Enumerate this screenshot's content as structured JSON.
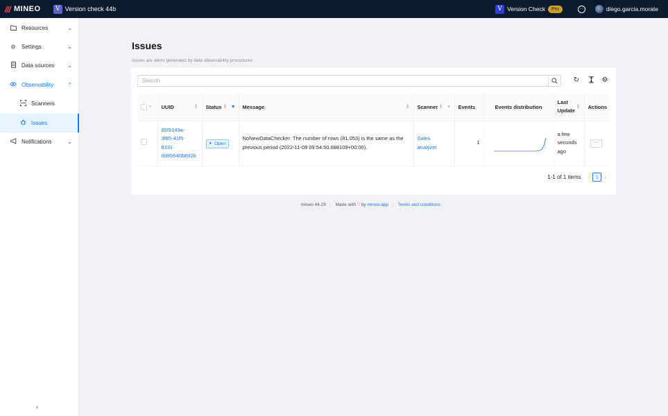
{
  "topbar": {
    "brand": "MINEO",
    "project_badge": "V",
    "project_name": "Version check 44b",
    "version_badge": "V",
    "version_name": "Version Check",
    "plan": "Pro",
    "user": "diego.garcia.morate"
  },
  "sidebar": {
    "items": [
      {
        "label": "Resources",
        "icon": "folder-icon"
      },
      {
        "label": "Settings",
        "icon": "gear-icon"
      },
      {
        "label": "Data sources",
        "icon": "database-icon"
      },
      {
        "label": "Observability",
        "icon": "eye-icon"
      },
      {
        "label": "Scanners",
        "icon": "scan-icon"
      },
      {
        "label": "Issues",
        "icon": "bug-icon"
      },
      {
        "label": "Notifications",
        "icon": "megaphone-icon"
      }
    ],
    "active": "Issues"
  },
  "page": {
    "title": "Issues",
    "subtitle": "Issues are alerts generated by data observability procedures"
  },
  "search": {
    "placeholder": "Search"
  },
  "table": {
    "columns": [
      "UUID",
      "Status",
      "Message",
      "Scanner",
      "Events",
      "Events distribution",
      "Last Update",
      "Actions"
    ],
    "rows": [
      {
        "uuid": "85f3143a-3f85-41f5-8331-dd85640b892b",
        "uuid_lines": [
          "85f3143a-",
          "3f85-41f5-",
          "8331-",
          "dd85640b892b"
        ],
        "status": "Open",
        "message": "NoNewDataChecker: The number of rows (81,053) is the same as the previous period (2022-11-09 09:54:50.688109+00:00).",
        "scanner": "Sales analyzer",
        "scanner_lines": [
          "Sales",
          "analyzer"
        ],
        "events": "1",
        "last_update": "a few seconds ago",
        "last_update_lines": [
          "a few",
          "seconds",
          "ago"
        ],
        "actions": "···"
      }
    ]
  },
  "pagination": {
    "summary": "1-1 of 1 items",
    "current": "1"
  },
  "footer": {
    "version": "mineo 44.29",
    "made_with": "Made with",
    "by": "by",
    "site": "mineo.app",
    "terms": "Terms and conditions"
  },
  "colors": {
    "accent": "#1677ff",
    "topbar": "#0b1a2e",
    "pro": "#c9a227"
  }
}
